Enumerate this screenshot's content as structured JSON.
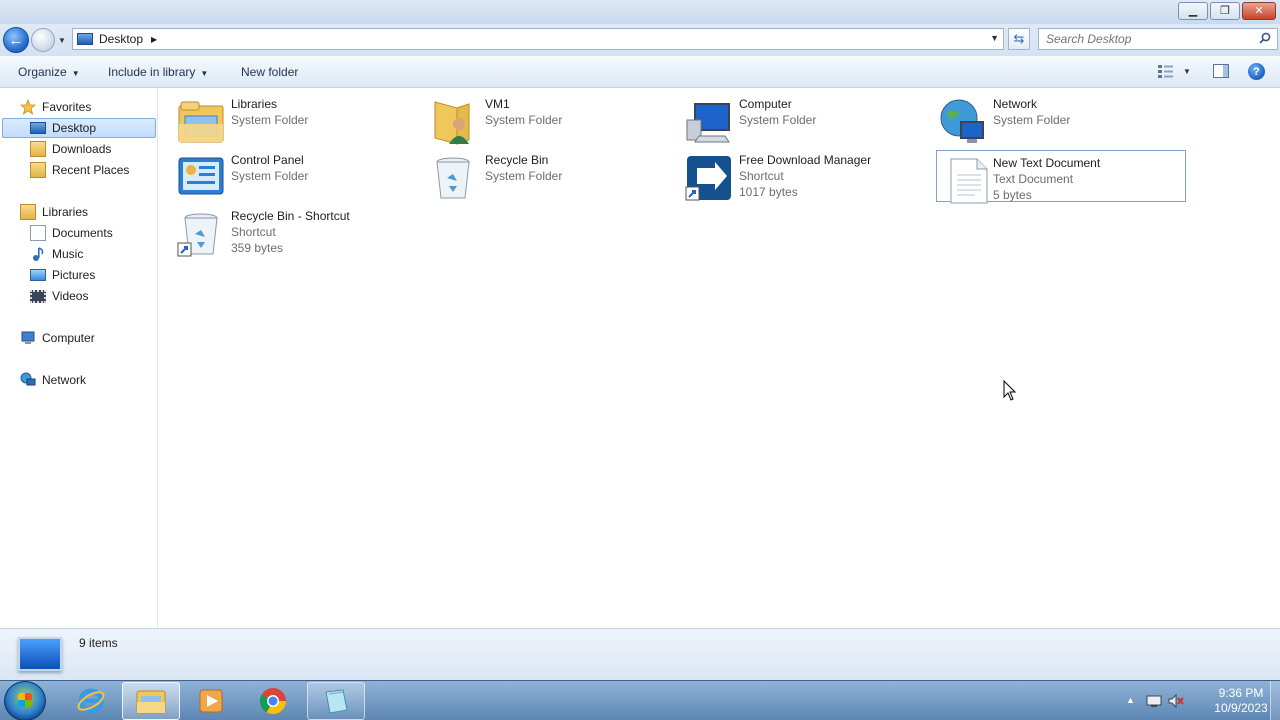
{
  "titlebar": {
    "controls": [
      "minimize",
      "maximize",
      "close"
    ]
  },
  "address": {
    "location": "Desktop",
    "search_placeholder": "Search Desktop"
  },
  "commands": {
    "organize": "Organize",
    "include_in_library": "Include in library",
    "new_folder": "New folder"
  },
  "navigation": {
    "favorites": {
      "label": "Favorites",
      "items": [
        "Desktop",
        "Downloads",
        "Recent Places"
      ]
    },
    "libraries": {
      "label": "Libraries",
      "items": [
        "Documents",
        "Music",
        "Pictures",
        "Videos"
      ]
    },
    "computer": "Computer",
    "network": "Network",
    "selected": "Desktop"
  },
  "items": [
    {
      "name": "Libraries",
      "type": "System Folder",
      "size": "",
      "icon": "libraries-icon"
    },
    {
      "name": "VM1",
      "type": "System Folder",
      "size": "",
      "icon": "user-folder-icon"
    },
    {
      "name": "Computer",
      "type": "System Folder",
      "size": "",
      "icon": "computer-icon"
    },
    {
      "name": "Network",
      "type": "System Folder",
      "size": "",
      "icon": "network-icon"
    },
    {
      "name": "Control Panel",
      "type": "System Folder",
      "size": "",
      "icon": "control-panel-icon"
    },
    {
      "name": "Recycle Bin",
      "type": "System Folder",
      "size": "",
      "icon": "recycle-bin-icon"
    },
    {
      "name": "Free Download Manager",
      "type": "Shortcut",
      "size": "1017 bytes",
      "icon": "fdm-shortcut-icon"
    },
    {
      "name": "New Text Document",
      "type": "Text Document",
      "size": "5 bytes",
      "icon": "text-document-icon"
    },
    {
      "name": "Recycle Bin - Shortcut",
      "type": "Shortcut",
      "size": "359 bytes",
      "icon": "recycle-bin-shortcut-icon"
    }
  ],
  "selected_item": "New Text Document",
  "details": {
    "count": "9 items"
  },
  "taskbar": {
    "pinned": [
      "internet-explorer",
      "windows-explorer",
      "media-player",
      "chrome",
      "notepad"
    ],
    "active": "windows-explorer",
    "clock_time": "9:36 PM",
    "clock_date": "10/9/2023"
  },
  "colors": {
    "accent": "#1e63c9",
    "selection": "#c1dcfc",
    "subtext": "#6d6d6d"
  }
}
